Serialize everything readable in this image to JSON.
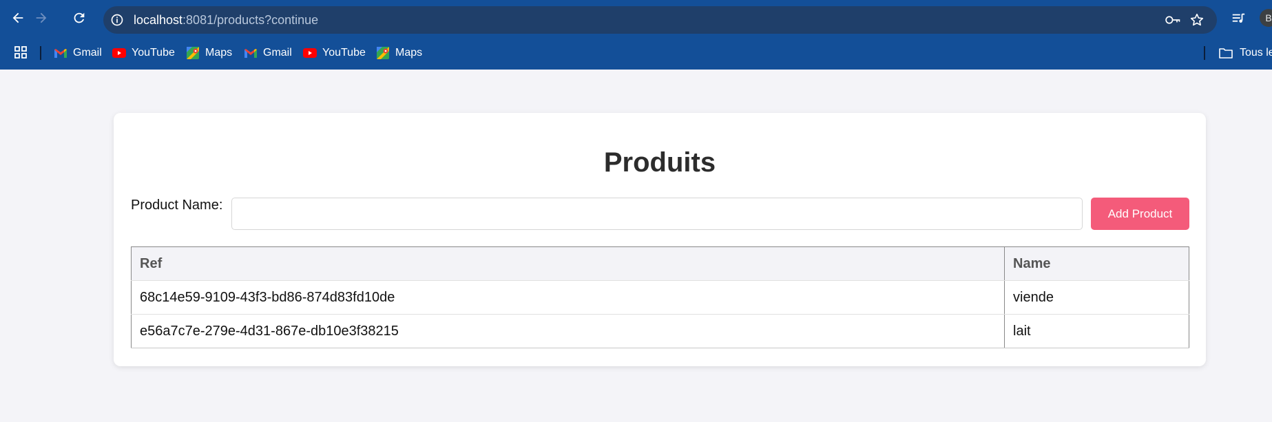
{
  "browser": {
    "url_host": "localhost",
    "url_path": ":8081/products?continue",
    "profile_initial": "B",
    "icons": {
      "back": "arrow-left-icon",
      "forward": "arrow-right-icon",
      "reload": "reload-icon",
      "site_info": "info-icon",
      "password": "key-icon",
      "bookmark": "star-icon",
      "media": "media-queue-icon"
    }
  },
  "bookmarks": {
    "items": [
      {
        "label": "Gmail",
        "icon": "gmail-icon"
      },
      {
        "label": "YouTube",
        "icon": "youtube-icon"
      },
      {
        "label": "Maps",
        "icon": "maps-icon"
      },
      {
        "label": "Gmail",
        "icon": "gmail-icon"
      },
      {
        "label": "YouTube",
        "icon": "youtube-icon"
      },
      {
        "label": "Maps",
        "icon": "maps-icon"
      }
    ],
    "all_bookmarks_label": "Tous les"
  },
  "page": {
    "title": "Produits",
    "form": {
      "label": "Product Name:",
      "input_value": "",
      "add_button": "Add Product"
    },
    "table": {
      "headers": [
        "Ref",
        "Name"
      ],
      "rows": [
        {
          "ref": "68c14e59-9109-43f3-bd86-874d83fd10de",
          "name": "viende"
        },
        {
          "ref": "e56a7c7e-279e-4d31-867e-db10e3f38215",
          "name": "lait"
        }
      ]
    }
  },
  "colors": {
    "toolbar": "#134f98",
    "omnibox": "#1f3f6a",
    "accent_button": "#f45b7a",
    "page_background": "#f4f4f8"
  }
}
